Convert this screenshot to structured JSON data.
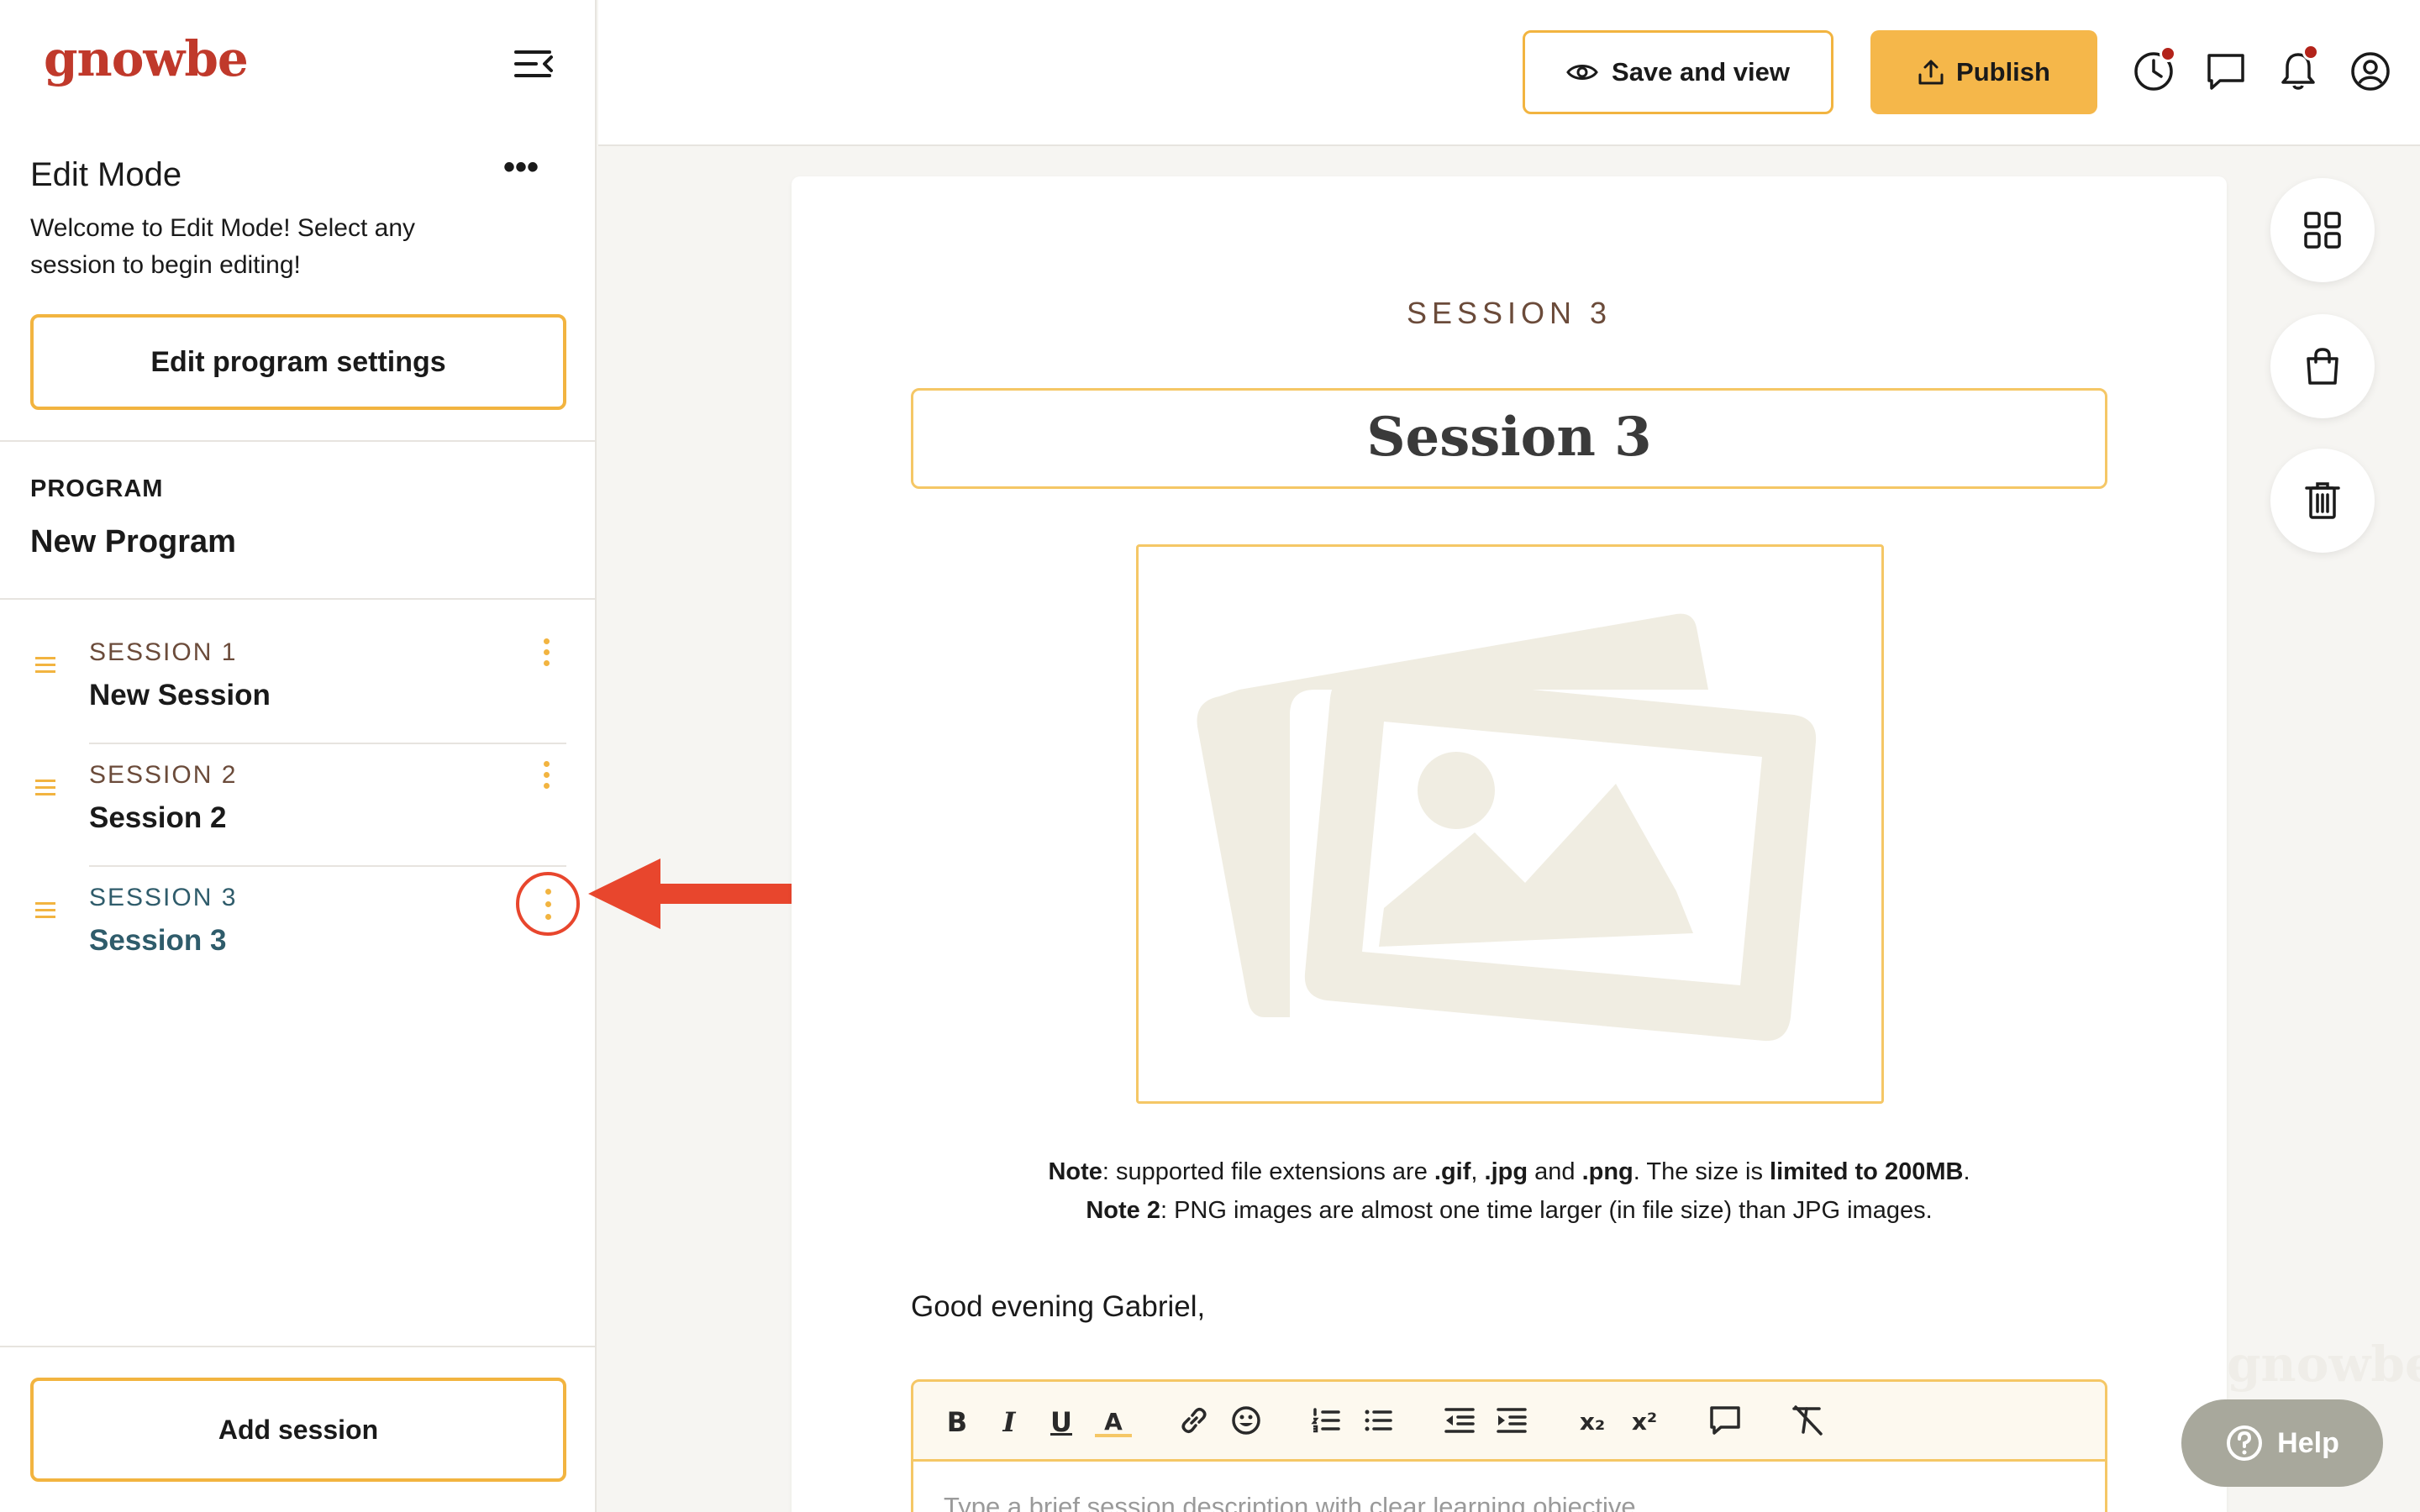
{
  "brand": {
    "logo_text": "gnowbe"
  },
  "sidebar": {
    "edit_mode_title": "Edit Mode",
    "more_label": "•••",
    "welcome_text": "Welcome to Edit Mode! Select any session to begin editing!",
    "edit_settings_label": "Edit program settings",
    "program_label": "PROGRAM",
    "program_name": "New Program",
    "sessions": [
      {
        "number": "SESSION 1",
        "title": "New Session"
      },
      {
        "number": "SESSION 2",
        "title": "Session 2"
      },
      {
        "number": "SESSION 3",
        "title": "Session 3"
      }
    ],
    "add_session_label": "Add session"
  },
  "topbar": {
    "save_view_label": "Save and view",
    "publish_label": "Publish"
  },
  "main": {
    "eyebrow": "SESSION 3",
    "title": "Session 3",
    "note1": {
      "b1": "Note",
      "t1": ": supported file extensions are ",
      "b2": ".gif",
      "t2": ", ",
      "b3": ".jpg",
      "t3": " and ",
      "b4": ".png",
      "t4": ". The size is ",
      "b5": "limited to 200MB",
      "t5": "."
    },
    "note2": {
      "b1": "Note 2",
      "t1": ": PNG images are almost one time larger (in file size) than JPG images."
    },
    "greeting": "Good evening Gabriel,",
    "toolbar": {
      "bold": "B",
      "italic": "I",
      "underline": "U",
      "font_color": "A",
      "subscript": "x₂",
      "superscript": "x²"
    },
    "description_placeholder": "Type a brief session description with clear learning objective"
  },
  "help": {
    "label": "Help"
  },
  "watermark": "gnowbe",
  "colors": {
    "accent": "#f2b440",
    "publish": "#f5b74a",
    "brand_red": "#c0392b",
    "active_session": "#2f5c6b",
    "highlight": "#e8462d"
  }
}
